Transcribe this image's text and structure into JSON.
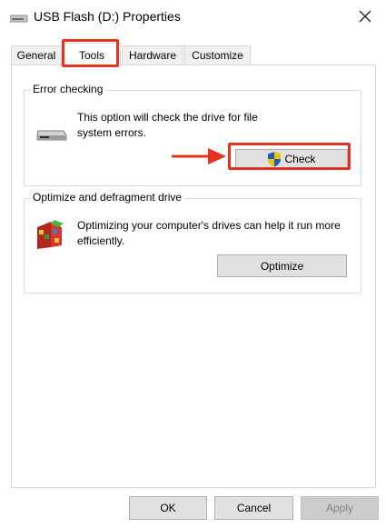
{
  "window": {
    "title": "USB Flash (D:) Properties",
    "icon": "usb-drive-icon",
    "close_icon": "close-icon"
  },
  "tabs": [
    {
      "label": "General",
      "active": false
    },
    {
      "label": "Tools",
      "active": true
    },
    {
      "label": "Hardware",
      "active": false
    },
    {
      "label": "Customize",
      "active": false
    }
  ],
  "error_checking": {
    "heading": "Error checking",
    "icon": "drive-icon",
    "description": "This option will check the drive for file system errors.",
    "button_label": "Check",
    "button_icon": "uac-shield-icon"
  },
  "optimize": {
    "heading": "Optimize and defragment drive",
    "icon": "defrag-icon",
    "description": "Optimizing your computer's drives can help it run more efficiently.",
    "button_label": "Optimize"
  },
  "footer": {
    "ok_label": "OK",
    "cancel_label": "Cancel",
    "apply_label": "Apply",
    "apply_enabled": false
  },
  "annotations": {
    "highlight_color": "#e8311f",
    "arrow_icon": "arrow-right-icon"
  }
}
